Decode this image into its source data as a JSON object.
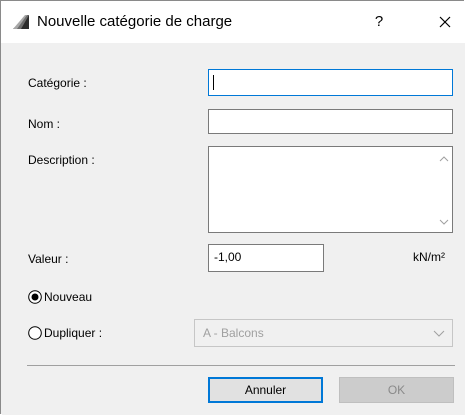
{
  "window": {
    "title": "Nouvelle catégorie de charge",
    "help_label": "?",
    "icon": "archicad-app-icon"
  },
  "form": {
    "categorie_label": "Catégorie :",
    "categorie_value": "",
    "nom_label": "Nom :",
    "nom_value": "",
    "description_label": "Description :",
    "description_value": "",
    "valeur_label": "Valeur :",
    "valeur_value": "-1,00",
    "unit": "kN/m²"
  },
  "options": {
    "nouveau_label": "Nouveau",
    "nouveau_selected": true,
    "dupliquer_label": "Dupliquer :",
    "dupliquer_selected": false,
    "dupliquer_combo_value": "A - Balcons"
  },
  "buttons": {
    "cancel_label": "Annuler",
    "ok_label": "OK"
  },
  "colors": {
    "focus_accent": "#0078d7",
    "dialog_bg": "#f0f0f0",
    "disabled_text": "#8a8a8a"
  }
}
